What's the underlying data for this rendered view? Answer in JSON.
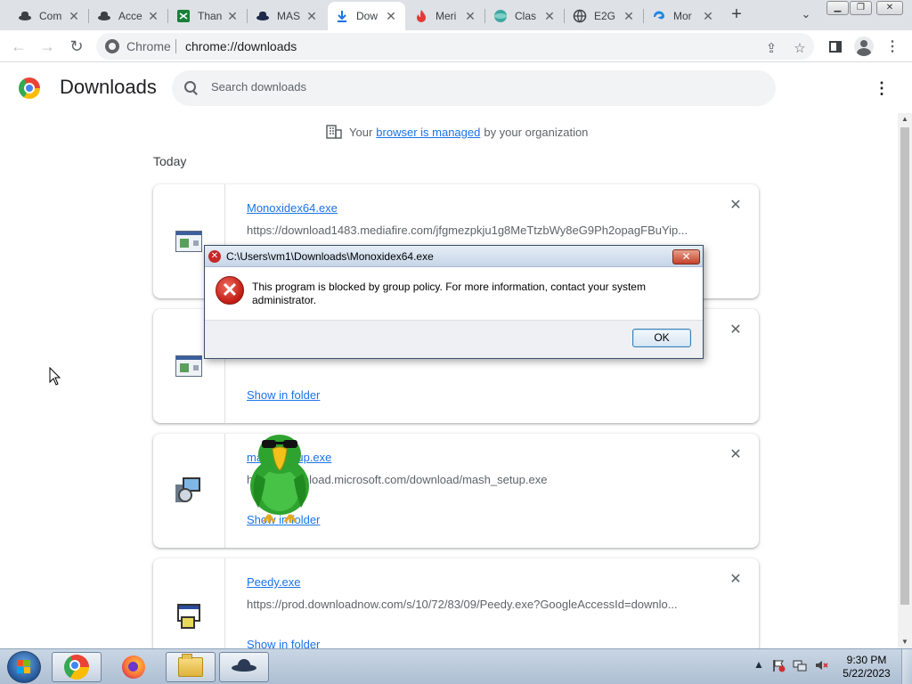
{
  "tabs": [
    {
      "label": "Com",
      "icon": "agent-icon",
      "active": false
    },
    {
      "label": "Acce",
      "icon": "agent-icon",
      "active": false
    },
    {
      "label": "Than",
      "icon": "sheet-icon",
      "active": false
    },
    {
      "label": "MAS",
      "icon": "agent-icon",
      "active": false
    },
    {
      "label": "Dow",
      "icon": "download-icon",
      "active": true
    },
    {
      "label": "Meri",
      "icon": "flame-icon",
      "active": false
    },
    {
      "label": "Clas",
      "icon": "globe-icon",
      "active": false
    },
    {
      "label": "E2G",
      "icon": "web-icon",
      "active": false
    },
    {
      "label": "Mor",
      "icon": "edge-icon",
      "active": false
    }
  ],
  "omnibox": {
    "chip": "Chrome",
    "url": "chrome://downloads"
  },
  "page": {
    "title": "Downloads",
    "search_placeholder": "Search downloads",
    "managed": {
      "before": "Your",
      "link": "browser is managed",
      "after": "by your organization"
    },
    "section_date": "Today"
  },
  "downloads": [
    {
      "filename": "Monoxidex64.exe",
      "url": "https://download1483.mediafire.com/jfgmezpkju1g8MeTtzbWy8eG9Ph2opagFBuYip...",
      "show": "",
      "icon": "exe-file-icon"
    },
    {
      "filename": "",
      "url": "",
      "show": "Show in folder",
      "icon": "exe-file-icon"
    },
    {
      "filename": "mash_setup.exe",
      "url": "https://download.microsoft.com/download/mash_setup.exe",
      "show": "Show in folder",
      "icon": "setup-file-icon"
    },
    {
      "filename": "Peedy.exe",
      "url": "https://prod.downloadnow.com/s/10/72/83/09/Peedy.exe?GoogleAccessId=downlo...",
      "show": "Show in folder",
      "icon": "peedy-file-icon"
    }
  ],
  "dialog": {
    "title": "C:\\Users\\vm1\\Downloads\\Monoxidex64.exe",
    "message": "This program is blocked by group policy. For more information, contact your system administrator.",
    "ok_label": "OK"
  },
  "taskbar": {
    "apps": [
      "chrome-icon",
      "firefox-icon",
      "explorer-icon",
      "agent-icon"
    ],
    "time": "9:30 PM",
    "date": "5/22/2023"
  },
  "colors": {
    "link": "#1a73e8",
    "tab_strip": "#dee1e6",
    "taskbar": "#b8c8da",
    "error_red": "#c01b12"
  }
}
